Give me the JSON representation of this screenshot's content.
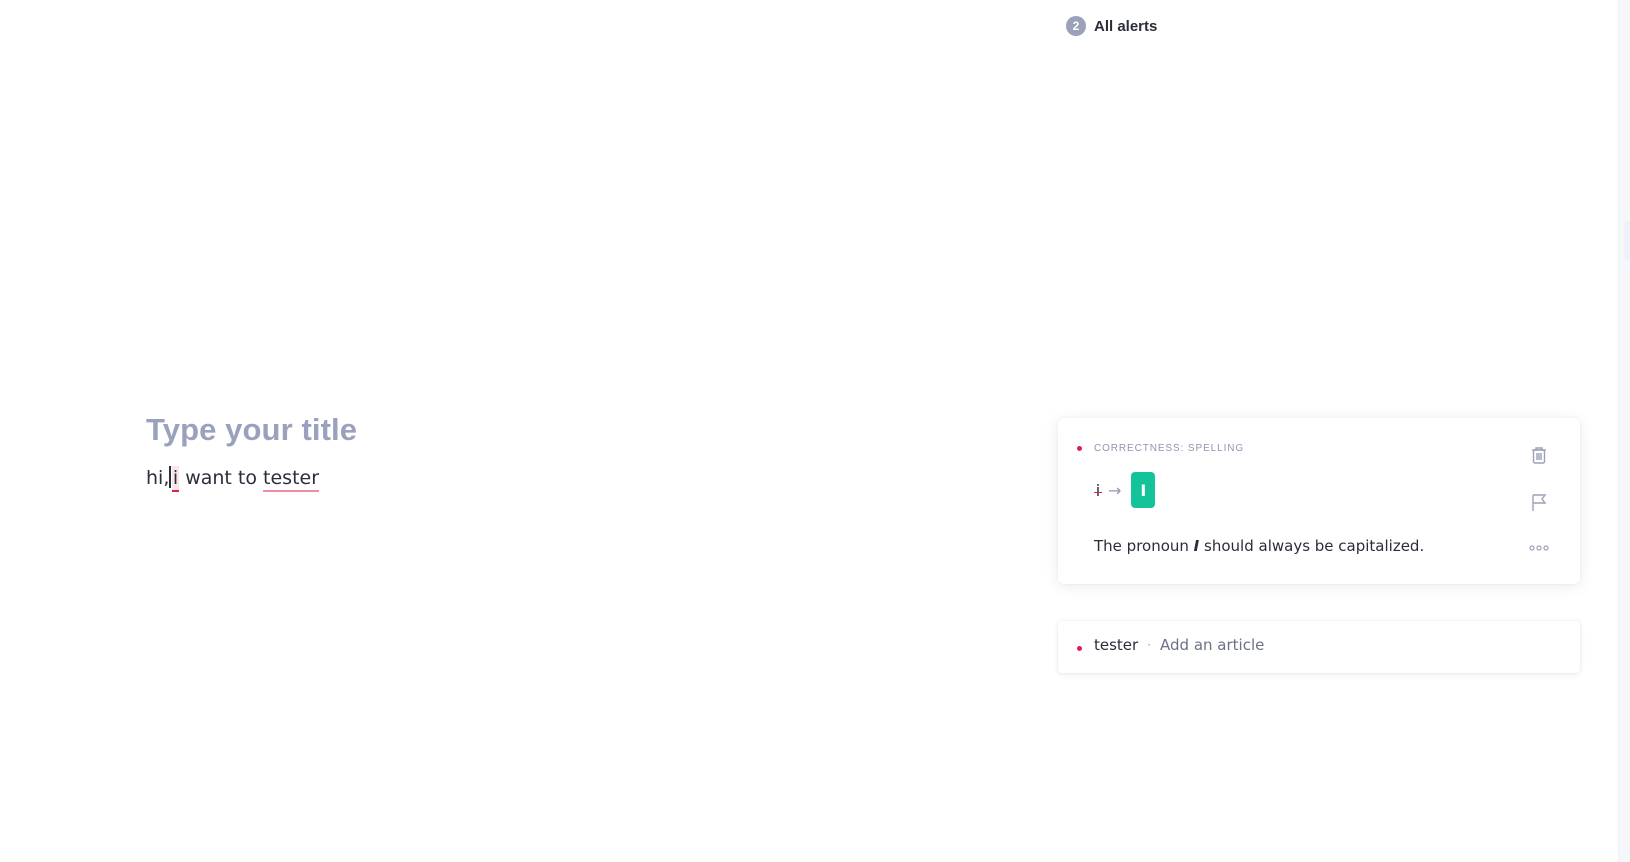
{
  "alerts": {
    "count": "2",
    "label": "All alerts"
  },
  "editor": {
    "title_placeholder": "Type your title",
    "body": {
      "before": "hi,",
      "flagged_spelling": "i",
      "middle": " want to ",
      "flagged_article": "tester"
    }
  },
  "active_card": {
    "category": "CORRECTNESS: SPELLING",
    "old_word": "i",
    "new_word": "I",
    "explanation_before": "The pronoun ",
    "explanation_emphasis": "I",
    "explanation_after": " should always be capitalized.",
    "icons": [
      "trash-icon",
      "flag-icon",
      "more-icon"
    ]
  },
  "collapsed_card": {
    "word": "tester",
    "separator": "·",
    "description": "Add an article"
  },
  "colors": {
    "accent_green": "#15c39a",
    "error_red": "#e01e4f",
    "muted": "#9aa1b8"
  }
}
